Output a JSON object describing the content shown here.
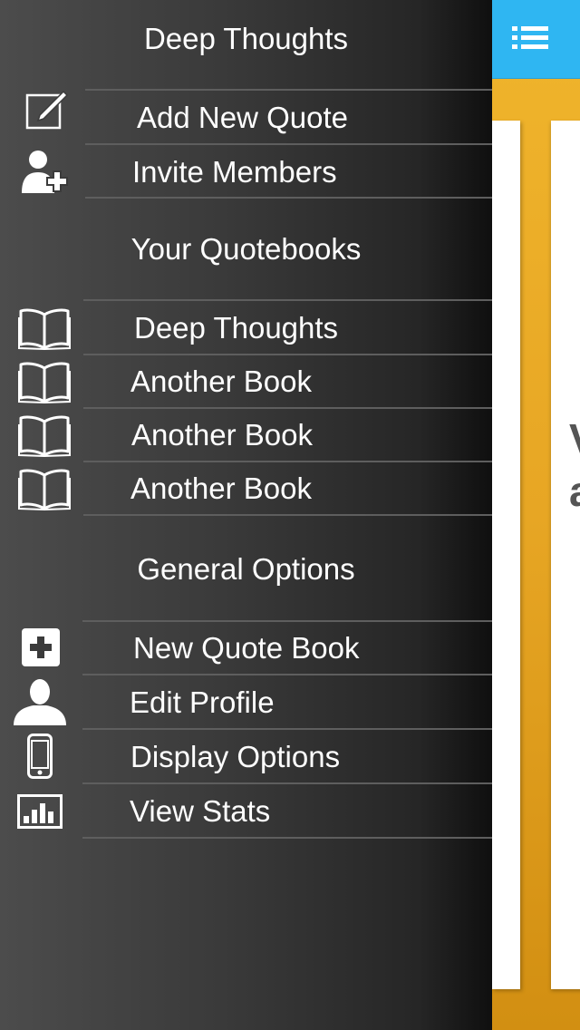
{
  "drawer": {
    "header_title": "Deep Thoughts",
    "top_items": [
      {
        "label": "Add New Quote",
        "icon": "compose-icon"
      },
      {
        "label": "Invite Members",
        "icon": "add-person-icon"
      }
    ],
    "quotebooks_heading": "Your Quotebooks",
    "quotebooks": [
      {
        "label": "Deep Thoughts",
        "icon": "book-icon"
      },
      {
        "label": "Another Book",
        "icon": "book-icon"
      },
      {
        "label": "Another Book",
        "icon": "book-icon"
      },
      {
        "label": "Another Book",
        "icon": "book-icon"
      }
    ],
    "general_heading": "General Options",
    "general_items": [
      {
        "label": "New Quote Book",
        "icon": "plus-box-icon"
      },
      {
        "label": "Edit Profile",
        "icon": "person-icon"
      },
      {
        "label": "Display Options",
        "icon": "phone-icon"
      },
      {
        "label": "View Stats",
        "icon": "bar-chart-icon"
      }
    ]
  },
  "content": {
    "menu_icon": "list-menu-icon",
    "peek_lines": [
      "V",
      "a"
    ]
  },
  "colors": {
    "topbar": "#2fb6f2",
    "accent_orange": "#e7a624",
    "drawer_dark": "#262626",
    "separator": "#5e5e5e"
  }
}
